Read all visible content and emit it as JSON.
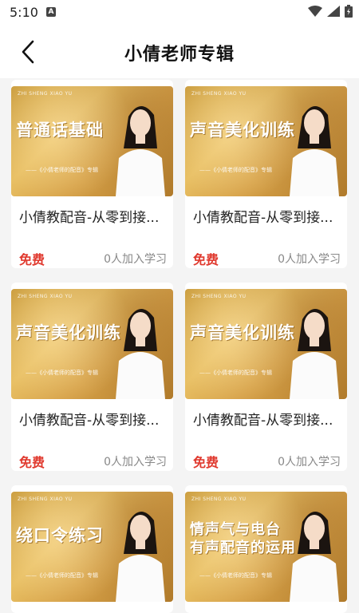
{
  "status_bar": {
    "time": "5:10",
    "notif_letter": "A"
  },
  "header": {
    "title": "小倩老师专辑"
  },
  "colors": {
    "accent": "#e03a2f",
    "thumb_gold": "#d6a148"
  },
  "courses": [
    {
      "headline": "普通话基础",
      "brand": "ZHI SHENG XIAO YU",
      "subline": "——《小倩老师的配音》专辑",
      "title": "小倩教配音-从零到接...",
      "price": "免费",
      "learners": "0人加入学习"
    },
    {
      "headline": "声音美化训练",
      "brand": "ZHI SHENG XIAO YU",
      "subline": "——《小倩老师的配音》专辑",
      "title": "小倩教配音-从零到接...",
      "price": "免费",
      "learners": "0人加入学习"
    },
    {
      "headline": "声音美化训练",
      "brand": "ZHI SHENG XIAO YU",
      "subline": "——《小倩老师的配音》专辑",
      "title": "小倩教配音-从零到接...",
      "price": "免费",
      "learners": "0人加入学习"
    },
    {
      "headline": "声音美化训练",
      "brand": "ZHI SHENG XIAO YU",
      "subline": "——《小倩老师的配音》专辑",
      "title": "小倩教配音-从零到接...",
      "price": "免费",
      "learners": "0人加入学习"
    },
    {
      "headline": "绕口令练习",
      "brand": "ZHI SHENG XIAO YU",
      "subline": "——《小倩老师的配音》专辑",
      "title": "",
      "price": "",
      "learners": ""
    },
    {
      "headline": "情声气与电台\n有声配音的运用",
      "brand": "ZHI SHENG XIAO YU",
      "subline": "——《小倩老师的配音》专辑",
      "title": "",
      "price": "",
      "learners": ""
    }
  ]
}
